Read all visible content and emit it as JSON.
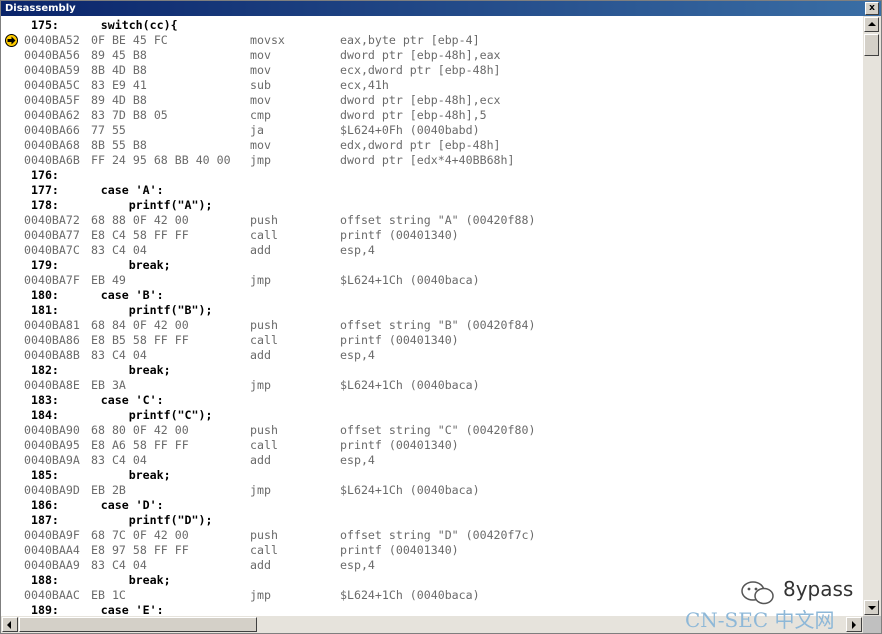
{
  "window": {
    "title": "Disassembly",
    "close_label": "x"
  },
  "current_line_index": 1,
  "lines": [
    {
      "kind": "src",
      "text": " 175:      switch(cc){"
    },
    {
      "kind": "asm",
      "addr": "0040BA52",
      "bytes": "0F BE 45 FC",
      "mnemonic": "movsx",
      "operands": "eax,byte ptr [ebp-4]"
    },
    {
      "kind": "asm",
      "addr": "0040BA56",
      "bytes": "89 45 B8",
      "mnemonic": "mov",
      "operands": "dword ptr [ebp-48h],eax"
    },
    {
      "kind": "asm",
      "addr": "0040BA59",
      "bytes": "8B 4D B8",
      "mnemonic": "mov",
      "operands": "ecx,dword ptr [ebp-48h]"
    },
    {
      "kind": "asm",
      "addr": "0040BA5C",
      "bytes": "83 E9 41",
      "mnemonic": "sub",
      "operands": "ecx,41h"
    },
    {
      "kind": "asm",
      "addr": "0040BA5F",
      "bytes": "89 4D B8",
      "mnemonic": "mov",
      "operands": "dword ptr [ebp-48h],ecx"
    },
    {
      "kind": "asm",
      "addr": "0040BA62",
      "bytes": "83 7D B8 05",
      "mnemonic": "cmp",
      "operands": "dword ptr [ebp-48h],5"
    },
    {
      "kind": "asm",
      "addr": "0040BA66",
      "bytes": "77 55",
      "mnemonic": "ja",
      "operands": "$L624+0Fh (0040babd)"
    },
    {
      "kind": "asm",
      "addr": "0040BA68",
      "bytes": "8B 55 B8",
      "mnemonic": "mov",
      "operands": "edx,dword ptr [ebp-48h]"
    },
    {
      "kind": "asm",
      "addr": "0040BA6B",
      "bytes": "FF 24 95 68 BB 40 00",
      "mnemonic": "jmp",
      "operands": "dword ptr [edx*4+40BB68h]"
    },
    {
      "kind": "src",
      "text": " 176:"
    },
    {
      "kind": "src",
      "text": " 177:      case 'A':"
    },
    {
      "kind": "src",
      "text": " 178:          printf(\"A\");"
    },
    {
      "kind": "asm",
      "addr": "0040BA72",
      "bytes": "68 88 0F 42 00",
      "mnemonic": "push",
      "operands": "offset string \"A\" (00420f88)"
    },
    {
      "kind": "asm",
      "addr": "0040BA77",
      "bytes": "E8 C4 58 FF FF",
      "mnemonic": "call",
      "operands": "printf (00401340)"
    },
    {
      "kind": "asm",
      "addr": "0040BA7C",
      "bytes": "83 C4 04",
      "mnemonic": "add",
      "operands": "esp,4"
    },
    {
      "kind": "src",
      "text": " 179:          break;"
    },
    {
      "kind": "asm",
      "addr": "0040BA7F",
      "bytes": "EB 49",
      "mnemonic": "jmp",
      "operands": "$L624+1Ch (0040baca)"
    },
    {
      "kind": "src",
      "text": " 180:      case 'B':"
    },
    {
      "kind": "src",
      "text": " 181:          printf(\"B\");"
    },
    {
      "kind": "asm",
      "addr": "0040BA81",
      "bytes": "68 84 0F 42 00",
      "mnemonic": "push",
      "operands": "offset string \"B\" (00420f84)"
    },
    {
      "kind": "asm",
      "addr": "0040BA86",
      "bytes": "E8 B5 58 FF FF",
      "mnemonic": "call",
      "operands": "printf (00401340)"
    },
    {
      "kind": "asm",
      "addr": "0040BA8B",
      "bytes": "83 C4 04",
      "mnemonic": "add",
      "operands": "esp,4"
    },
    {
      "kind": "src",
      "text": " 182:          break;"
    },
    {
      "kind": "asm",
      "addr": "0040BA8E",
      "bytes": "EB 3A",
      "mnemonic": "jmp",
      "operands": "$L624+1Ch (0040baca)"
    },
    {
      "kind": "src",
      "text": " 183:      case 'C':"
    },
    {
      "kind": "src",
      "text": " 184:          printf(\"C\");"
    },
    {
      "kind": "asm",
      "addr": "0040BA90",
      "bytes": "68 80 0F 42 00",
      "mnemonic": "push",
      "operands": "offset string \"C\" (00420f80)"
    },
    {
      "kind": "asm",
      "addr": "0040BA95",
      "bytes": "E8 A6 58 FF FF",
      "mnemonic": "call",
      "operands": "printf (00401340)"
    },
    {
      "kind": "asm",
      "addr": "0040BA9A",
      "bytes": "83 C4 04",
      "mnemonic": "add",
      "operands": "esp,4"
    },
    {
      "kind": "src",
      "text": " 185:          break;"
    },
    {
      "kind": "asm",
      "addr": "0040BA9D",
      "bytes": "EB 2B",
      "mnemonic": "jmp",
      "operands": "$L624+1Ch (0040baca)"
    },
    {
      "kind": "src",
      "text": " 186:      case 'D':"
    },
    {
      "kind": "src",
      "text": " 187:          printf(\"D\");"
    },
    {
      "kind": "asm",
      "addr": "0040BA9F",
      "bytes": "68 7C 0F 42 00",
      "mnemonic": "push",
      "operands": "offset string \"D\" (00420f7c)"
    },
    {
      "kind": "asm",
      "addr": "0040BAA4",
      "bytes": "E8 97 58 FF FF",
      "mnemonic": "call",
      "operands": "printf (00401340)"
    },
    {
      "kind": "asm",
      "addr": "0040BAA9",
      "bytes": "83 C4 04",
      "mnemonic": "add",
      "operands": "esp,4"
    },
    {
      "kind": "src",
      "text": " 188:          break;"
    },
    {
      "kind": "asm",
      "addr": "0040BAAC",
      "bytes": "EB 1C",
      "mnemonic": "jmp",
      "operands": "$L624+1Ch (0040baca)"
    },
    {
      "kind": "src",
      "text": " 189:      case 'E':"
    }
  ],
  "watermark": {
    "brand": "8ypass",
    "site": "CN-SEC 中文网"
  },
  "colors": {
    "title_bar": "#0a246a",
    "code_text": "#6a6a6a",
    "source_text": "#000000",
    "current_arrow": "#ffcc00"
  },
  "icons": {
    "current_instruction": "yellow-arrow-icon"
  }
}
